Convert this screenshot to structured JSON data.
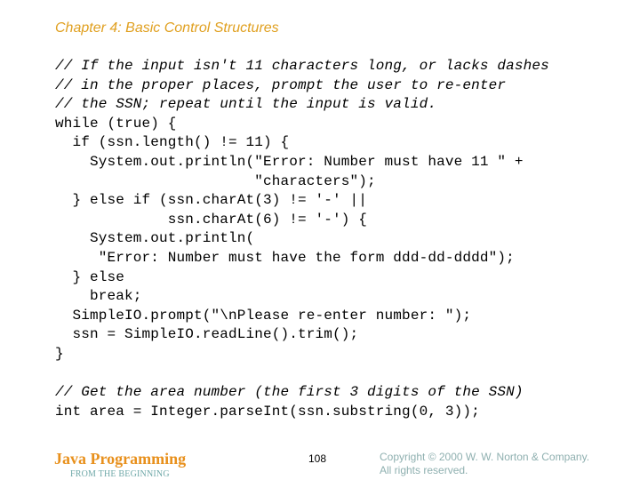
{
  "slide": {
    "chapter_title": "Chapter 4: Basic Control Structures",
    "code_lines": [
      {
        "text": "// If the input isn't 11 characters long, or lacks dashes",
        "kind": "comment"
      },
      {
        "text": "// in the proper places, prompt the user to re-enter",
        "kind": "comment"
      },
      {
        "text": "// the SSN; repeat until the input is valid.",
        "kind": "comment"
      },
      {
        "text": "while (true) {",
        "kind": "code"
      },
      {
        "text": "  if (ssn.length() != 11) {",
        "kind": "code"
      },
      {
        "text": "    System.out.println(\"Error: Number must have 11 \" +",
        "kind": "code"
      },
      {
        "text": "                       \"characters\");",
        "kind": "code"
      },
      {
        "text": "  } else if (ssn.charAt(3) != '-' ||",
        "kind": "code"
      },
      {
        "text": "             ssn.charAt(6) != '-') {",
        "kind": "code"
      },
      {
        "text": "    System.out.println(",
        "kind": "code"
      },
      {
        "text": "     \"Error: Number must have the form ddd-dd-dddd\");",
        "kind": "code"
      },
      {
        "text": "  } else",
        "kind": "code"
      },
      {
        "text": "    break;",
        "kind": "code"
      },
      {
        "text": "  SimpleIO.prompt(\"\\nPlease re-enter number: \");",
        "kind": "code"
      },
      {
        "text": "  ssn = SimpleIO.readLine().trim();",
        "kind": "code"
      },
      {
        "text": "}",
        "kind": "code"
      }
    ],
    "code_lines_2": [
      {
        "text": "// Get the area number (the first 3 digits of the SSN)",
        "kind": "comment"
      },
      {
        "text": "int area = Integer.parseInt(ssn.substring(0, 3));",
        "kind": "code"
      }
    ]
  },
  "footer": {
    "brand_title": "Java Programming",
    "brand_subtitle": "FROM THE BEGINNING",
    "page_number": "108",
    "copyright_line1": "Copyright © 2000 W. W. Norton & Company.",
    "copyright_line2": "All rights reserved."
  },
  "colors": {
    "chapter_title": "#e0a020",
    "brand_title": "#e8901c",
    "brand_subtitle": "#6fa8a8",
    "copyright": "#8fb0b0",
    "code": "#000000"
  }
}
